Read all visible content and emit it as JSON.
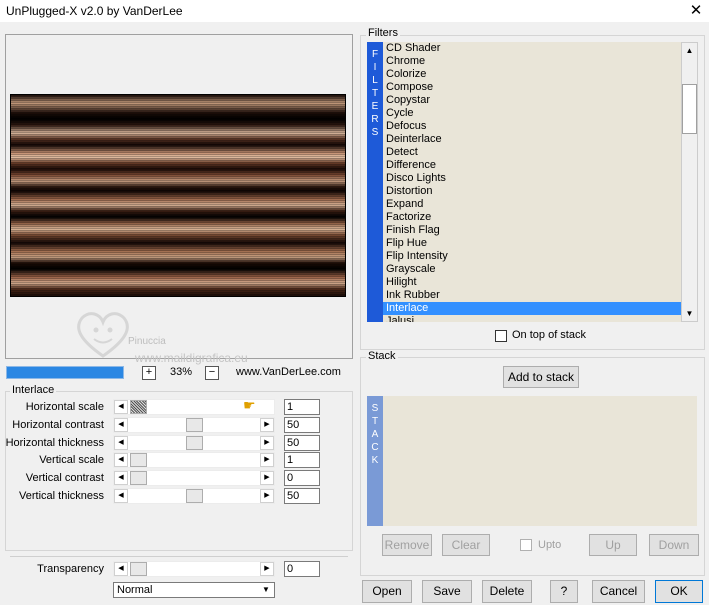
{
  "window": {
    "title": "UnPlugged-X v2.0 by VanDerLee",
    "close_glyph": "✕"
  },
  "preview": {
    "watermark_name": "Pinuccia",
    "watermark_url": "www.maildigrafica.eu"
  },
  "zoom": {
    "plus": "+",
    "minus": "−",
    "value": "33%",
    "site_url": "www.VanDerLee.com",
    "progress_fill": 1.0
  },
  "interlace": {
    "legend": "Interlace",
    "params": [
      {
        "label": "Horizontal scale",
        "value": "1"
      },
      {
        "label": "Horizontal contrast",
        "value": "50"
      },
      {
        "label": "Horizontal thickness",
        "value": "50"
      },
      {
        "label": "Vertical scale",
        "value": "1"
      },
      {
        "label": "Vertical contrast",
        "value": "0"
      },
      {
        "label": "Vertical thickness",
        "value": "50"
      }
    ]
  },
  "transparency": {
    "label": "Transparency",
    "value": "0",
    "mode": "Normal"
  },
  "filters": {
    "legend": "Filters",
    "strip_text": "FILTERS",
    "items": [
      "CD Shader",
      "Chrome",
      "Colorize",
      "Compose",
      "Copystar",
      "Cycle",
      "Defocus",
      "Deinterlace",
      "Detect",
      "Difference",
      "Disco Lights",
      "Distortion",
      "Expand",
      "Factorize",
      "Finish Flag",
      "Flip Hue",
      "Flip Intensity",
      "Grayscale",
      "Hilight",
      "Ink Rubber",
      "Interlace",
      "Jalusi"
    ],
    "selected": "Interlace",
    "on_top_label": "On top of stack"
  },
  "stack": {
    "legend": "Stack",
    "add_label": "Add to stack",
    "strip_text": "STACK",
    "remove": "Remove",
    "clear": "Clear",
    "upto": "Upto",
    "up": "Up",
    "down": "Down"
  },
  "buttons": {
    "open": "Open",
    "save": "Save",
    "delete": "Delete",
    "help": "?",
    "cancel": "Cancel",
    "ok": "OK"
  },
  "colors": {
    "progress": "#2b87e3",
    "filter_strip": "#1e5ad8",
    "selection": "#3390ff",
    "list_bg": "#e9e5d8"
  }
}
